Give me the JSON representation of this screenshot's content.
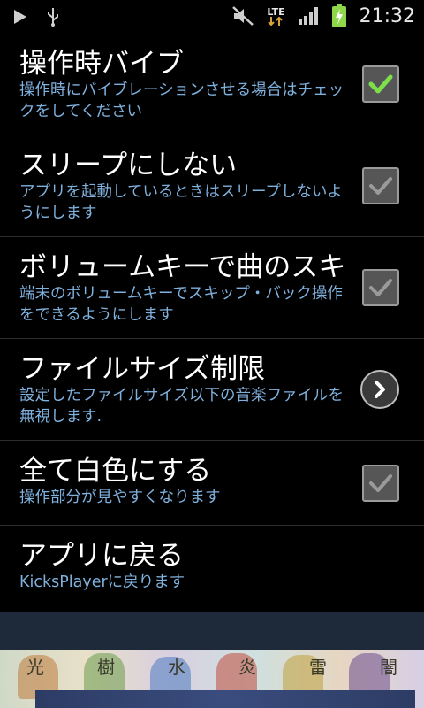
{
  "status_bar": {
    "time": "21:32",
    "network": "LTE",
    "icons": [
      "play-icon",
      "usb-icon",
      "mute-icon",
      "lte-icon",
      "signal-icon",
      "battery-charging-icon"
    ]
  },
  "settings": [
    {
      "title": "操作時バイブ",
      "desc": "操作時にバイブレーションさせる場合はチェックをしてください",
      "control": "checkbox",
      "checked": true,
      "enabled": true
    },
    {
      "title": "スリープにしない",
      "desc": "アプリを起動しているときはスリープしないようにします",
      "control": "checkbox",
      "checked": true,
      "enabled": false
    },
    {
      "title": "ボリュームキーで曲のスキ",
      "desc": "端末のボリュームキーでスキップ・バック操作をできるようにします",
      "control": "checkbox",
      "checked": true,
      "enabled": false
    },
    {
      "title": "ファイルサイズ制限",
      "desc": "設定したファイルサイズ以下の音楽ファイルを無視します.",
      "control": "chevron"
    },
    {
      "title": "全て白色にする",
      "desc": "操作部分が見やすくなります",
      "control": "checkbox",
      "checked": true,
      "enabled": false
    },
    {
      "title": "アプリに戻る",
      "desc": "KicksPlayerに戻ります",
      "control": "none"
    }
  ],
  "colors": {
    "accent_check": "#7de04a",
    "desc_text": "#7fb1de",
    "disabled_check": "#9a9a9a"
  },
  "ad_banner": {
    "glyphs": [
      "光",
      "樹",
      "水",
      "炎",
      "雷",
      "闇"
    ]
  }
}
